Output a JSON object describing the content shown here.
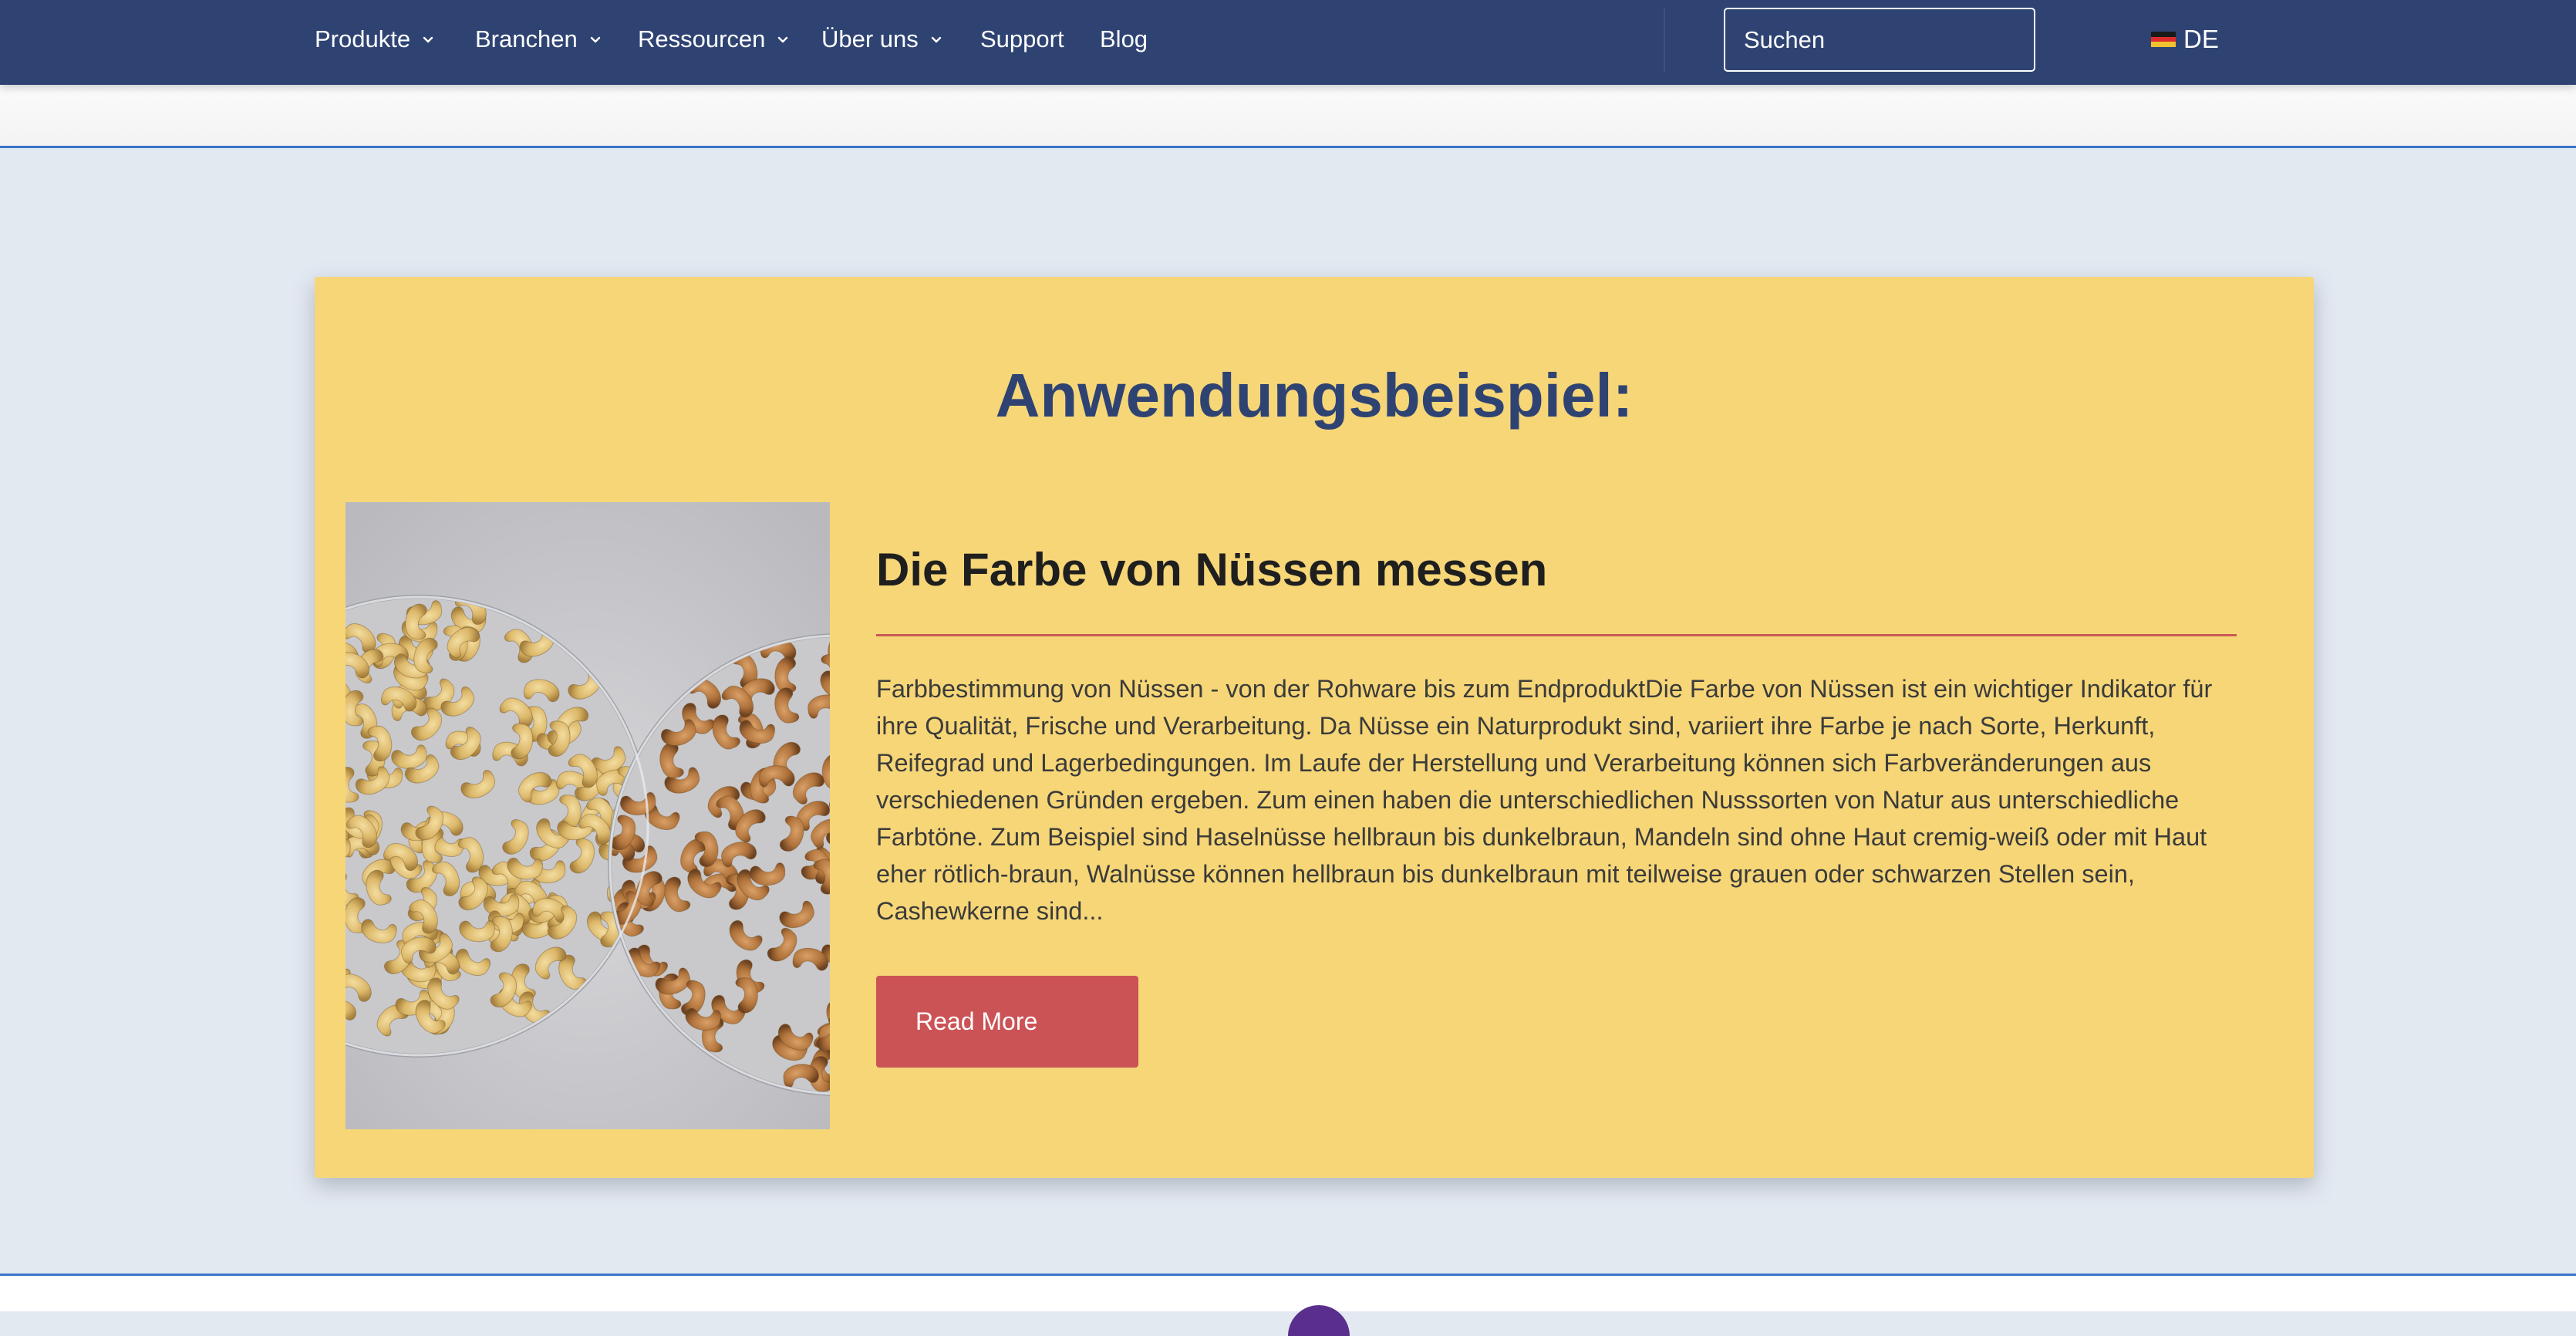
{
  "nav": {
    "items": [
      {
        "label": "Produkte",
        "dropdown": true
      },
      {
        "label": "Branchen",
        "dropdown": true
      },
      {
        "label": "Ressourcen",
        "dropdown": true
      },
      {
        "label": "Über uns",
        "dropdown": true
      },
      {
        "label": "Support",
        "dropdown": false
      },
      {
        "label": "Blog",
        "dropdown": false
      }
    ],
    "search_placeholder": "Suchen",
    "language": "DE",
    "language_flag_icon": "flag-germany-icon"
  },
  "example": {
    "heading": "Anwendungsbeispiel:",
    "article_title": "Die Farbe von Nüssen messen",
    "excerpt": "Farbbestimmung von Nüssen - von der Rohware bis zum EndproduktDie Farbe von Nüssen ist ein wichtiger Indikator für ihre Qualität, Frische und Verarbeitung. Da Nüsse ein Naturprodukt sind, variiert ihre Farbe je nach Sorte, Herkunft, Reifegrad und Lagerbedingungen. Im Laufe der Herstellung und Verarbeitung können sich Farbveränderungen aus verschiedenen Gründen ergeben. Zum einen haben die unterschiedlichen Nusssorten von Natur aus unterschiedliche Farbtöne. Zum Beispiel sind Haselnüsse hellbraun bis dunkelbraun, Mandeln sind ohne Haut cremig-weiß oder mit Haut eher rötlich-braun, Walnüsse können hellbraun bis dunkelbraun mit teilweise grauen oder schwarzen Stellen sein, Cashewkerne sind...",
    "read_more_label": "Read More",
    "image_subject": "cashew-dishes-photo"
  },
  "colors": {
    "nav_bg": "#2f4373",
    "card_bg": "#f6d677",
    "heading": "#2f4373",
    "accent_red": "#cb5356",
    "rule_red": "#c85a54",
    "page_bg": "#e3e9f1",
    "divider_blue": "#3a75c8"
  }
}
